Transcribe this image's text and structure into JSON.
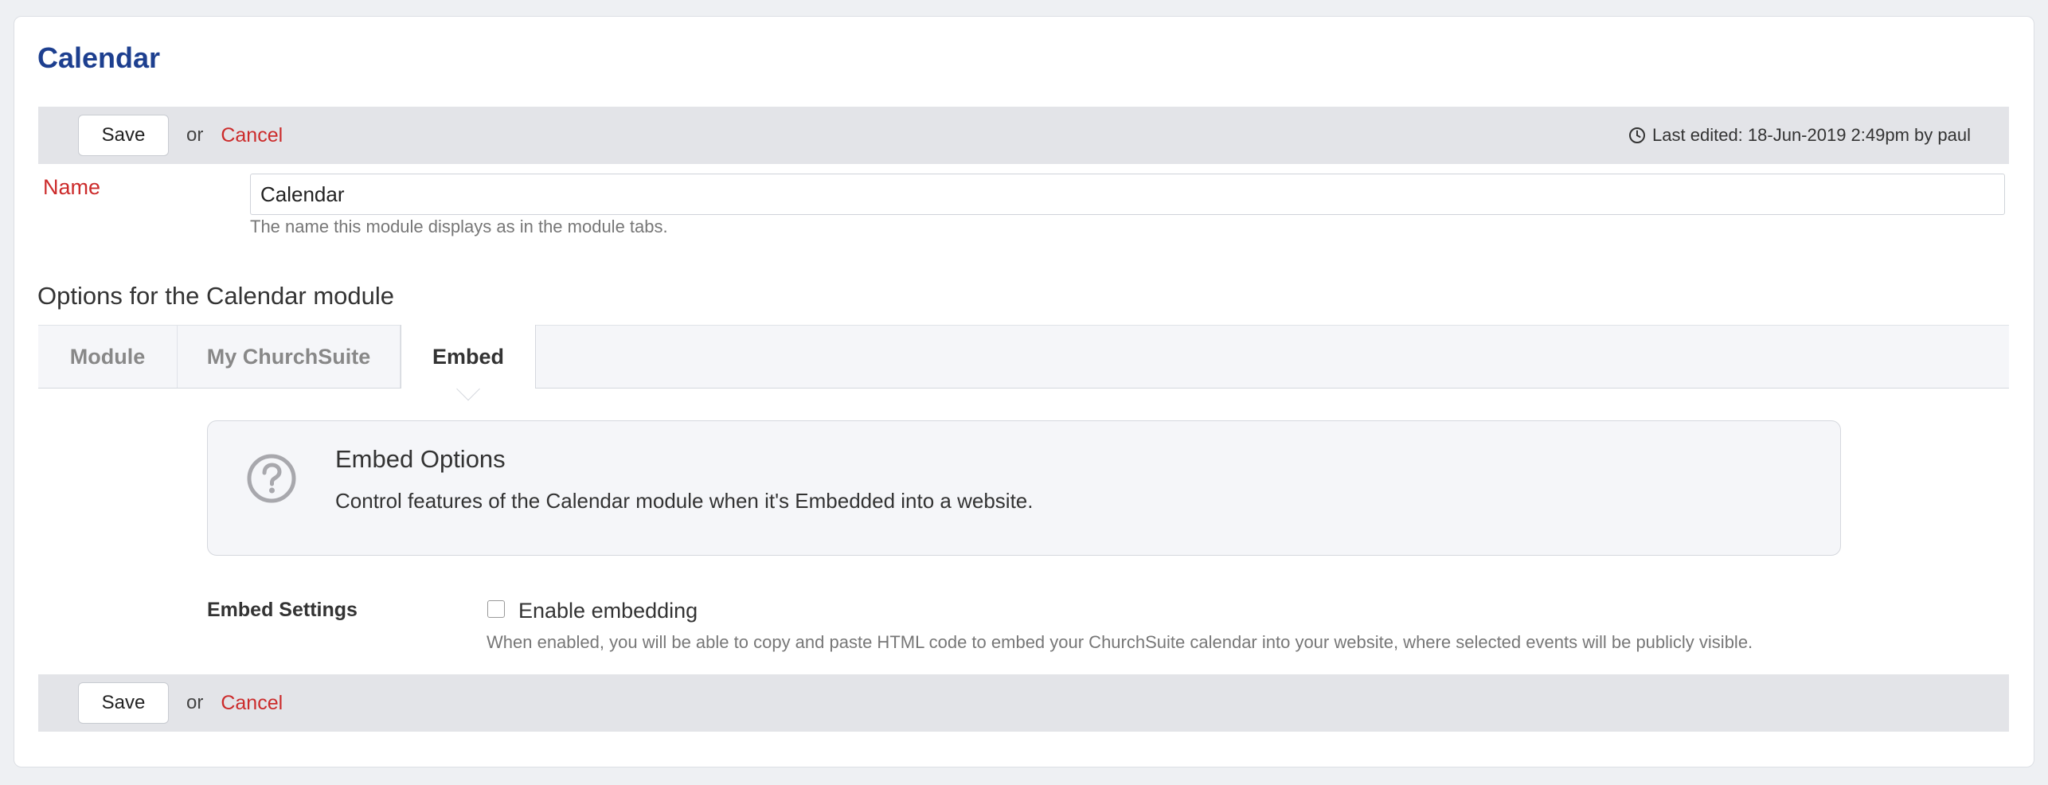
{
  "page": {
    "title": "Calendar"
  },
  "actions": {
    "save_label": "Save",
    "or_text": "or",
    "cancel_label": "Cancel"
  },
  "meta": {
    "last_edited": "Last edited: 18-Jun-2019 2:49pm by paul"
  },
  "name_field": {
    "label": "Name",
    "value": "Calendar",
    "help": "The name this module displays as in the module tabs."
  },
  "options": {
    "heading": "Options for the Calendar module",
    "tabs": [
      {
        "label": "Module"
      },
      {
        "label": "My ChurchSuite"
      },
      {
        "label": "Embed"
      }
    ],
    "active_tab": "Embed"
  },
  "info": {
    "title": "Embed Options",
    "text": "Control features of the Calendar module when it's Embedded into a website.",
    "icon": "question-circle-icon"
  },
  "embed_settings": {
    "label": "Embed Settings",
    "checkbox_label": "Enable embedding",
    "checked": false,
    "help": "When enabled, you will be able to copy and paste HTML code to embed your ChurchSuite calendar into your website, where selected events will be publicly visible."
  },
  "colors": {
    "title": "#1d3f8f",
    "cancel": "#cc2b2b",
    "label_required": "#cc2b2b",
    "bar_bg": "#e3e4e8"
  }
}
